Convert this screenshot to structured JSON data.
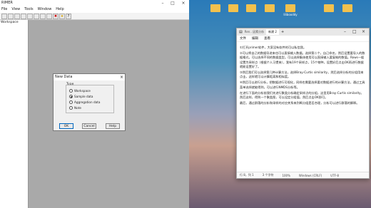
{
  "app": {
    "title": "RIMER",
    "menu": [
      "File",
      "View",
      "Tools",
      "Window",
      "Help"
    ],
    "tree_root": "Workspace"
  },
  "dialog": {
    "title": "New Data",
    "group": "Type",
    "options": [
      "Workspace",
      "Sample data",
      "Aggregation data",
      "Note"
    ],
    "selected": 1,
    "ok": "OK",
    "cancel": "Cancel",
    "help": "Help"
  },
  "desktop": {
    "icons": [
      "",
      "",
      "",
      "",
      "lilibooddy",
      "",
      ""
    ]
  },
  "notepad": {
    "tabs": [
      "Ren.. 因素分析",
      "新建 2"
    ],
    "menu": [
      "文件",
      "编辑",
      "查看"
    ],
    "paragraphs": [
      "①打开primer软件，大家没有软件的可以私信我。",
      "②可以将自己的数据导进来也可以直接输入数据。选择第二个，自己命名。然后设置要导入的数据格式，可以选择不同的数据类型。可以选择集体使用可以直接输入要复制的数值。Rows一般设置为采样点（根据个人习惯来），我有19个采样点，15个物种，设置好后点击OK再进行数据就能设置好了。",
      "③然后我们可以选择第几种计算方法，选择Bray-Curtis similarity，然后选择分析的分组用来点击，这样就可以计算距离和相似度。",
      "④然后可以进行分析，把数据进行可视化，同样也需要选择要对数据进行的计算方法，通过工具菜单选择就能得到，可以进行NMDS分析等。",
      "在进行下面的分析前我们先进行聚类分析确定采样点的分组，这里用Bray-Curtis similarity，然后这样，得到一个聚类图，可以设定分组值，然后点击OK即可。",
      "最后，通过群落的分析和采样的对应关系来判断分组是否合理，分析可以进行群落的解释。"
    ],
    "status": [
      "行 8，列 1",
      "3 个字符",
      "100%",
      "Windows (CRLF)",
      "UTF-8"
    ]
  }
}
